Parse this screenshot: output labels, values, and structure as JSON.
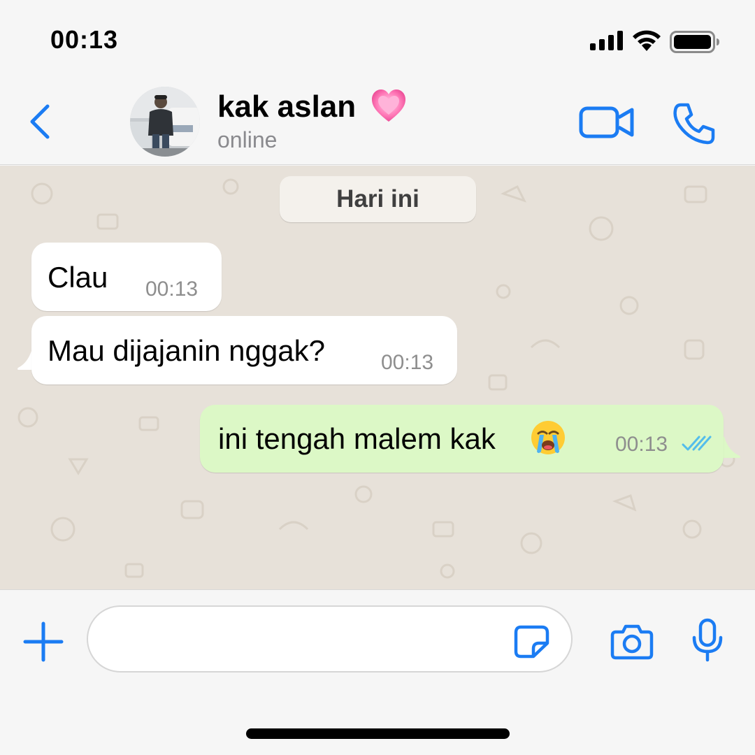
{
  "status_bar": {
    "time": "00:13",
    "icons": [
      "cellular-signal-icon",
      "wifi-icon",
      "battery-icon"
    ]
  },
  "header": {
    "back_icon": "chevron-left-icon",
    "contact_name": "kak aslan",
    "name_emoji": "pink-heart",
    "status": "online",
    "actions": [
      "video-call-icon",
      "phone-icon"
    ]
  },
  "chat": {
    "date_label": "Hari ini",
    "messages": [
      {
        "direction": "incoming",
        "text": "Clau",
        "time": "00:13"
      },
      {
        "direction": "incoming",
        "text": "Mau dijajanin nggak?",
        "time": "00:13"
      },
      {
        "direction": "outgoing",
        "text": "ini tengah malem kak",
        "emoji": "loudly-crying-face",
        "time": "00:13",
        "status": "read"
      }
    ]
  },
  "input_bar": {
    "placeholder": "",
    "value": "",
    "icons": [
      "plus-icon",
      "sticker-icon",
      "camera-icon",
      "microphone-icon"
    ]
  },
  "colors": {
    "accent": "#1b7cf3",
    "outgoing_bubble": "#dcf8c6",
    "incoming_bubble": "#ffffff",
    "chat_background": "#e7e1d9",
    "read_ticks": "#53bdeb"
  }
}
